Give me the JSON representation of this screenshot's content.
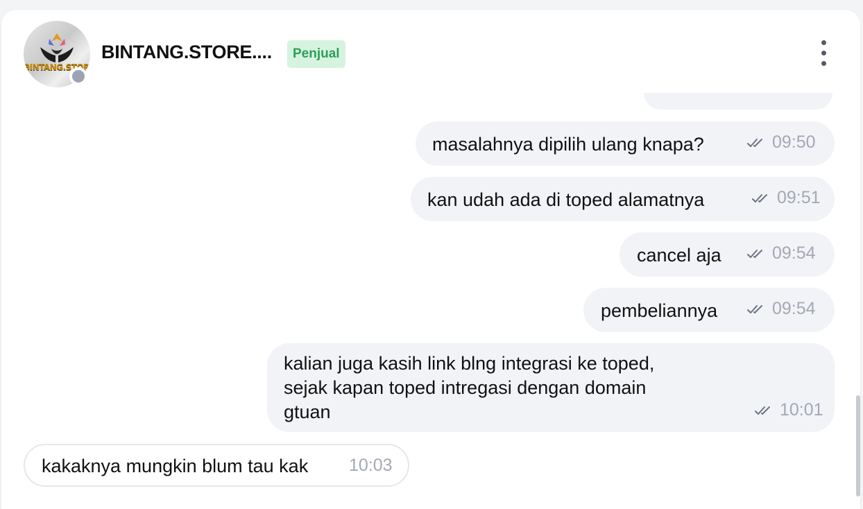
{
  "header": {
    "store_name": "BINTANG.STORE....",
    "role_badge": "Penjual",
    "avatar_logo_text": "BINTANG.STORE",
    "status": "offline",
    "more_icon": "more-vertical-icon"
  },
  "colors": {
    "outgoing_bubble": "#f2f3f6",
    "incoming_bubble": "#ffffff",
    "badge_bg": "#d6f3df",
    "badge_text": "#2e9e57",
    "timestamp": "#a3a8b4",
    "status_dot": "#9ca3b4"
  },
  "messages": [
    {
      "direction": "outgoing",
      "text": "masalahnya dipilih ulang knapa?",
      "time": "09:50",
      "read_icon": "double-check-icon"
    },
    {
      "direction": "outgoing",
      "text": "kan udah ada di toped alamatnya",
      "time": "09:51",
      "read_icon": "double-check-icon"
    },
    {
      "direction": "outgoing",
      "text": "cancel aja",
      "time": "09:54",
      "read_icon": "double-check-icon"
    },
    {
      "direction": "outgoing",
      "text": "pembeliannya",
      "time": "09:54",
      "read_icon": "double-check-icon"
    },
    {
      "direction": "outgoing",
      "lines": [
        "kalian juga kasih link blng integrasi ke toped,",
        "sejak kapan toped intregasi dengan domain",
        "gtuan"
      ],
      "time": "10:01",
      "read_icon": "double-check-icon"
    },
    {
      "direction": "incoming",
      "text": "kakaknya mungkin blum tau kak",
      "time": "10:03"
    }
  ]
}
